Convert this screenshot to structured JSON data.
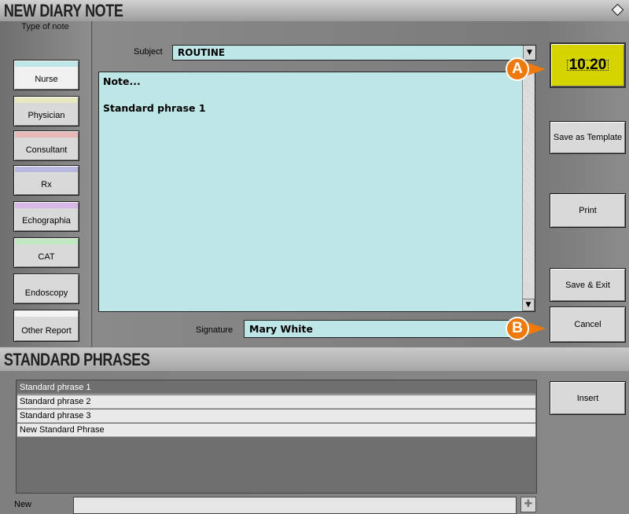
{
  "header": {
    "title": "NEW DIARY NOTE",
    "window_icon": "diamond-icon"
  },
  "note_types": {
    "label": "Type of note",
    "items": [
      {
        "label": "Nurse",
        "color": "#bfe6e6"
      },
      {
        "label": "Physician",
        "color": "#e8e8c0"
      },
      {
        "label": "Consultant",
        "color": "#e8b8b8"
      },
      {
        "label": "Rx",
        "color": "#b8b8e0"
      },
      {
        "label": "Echographia",
        "color": "#d8b8e8"
      },
      {
        "label": "CAT",
        "color": "#c0e8c0"
      },
      {
        "label": "Endoscopy",
        "color": "#d8d8d8"
      },
      {
        "label": "Other Report",
        "color": "#f0f0f0"
      }
    ]
  },
  "subject": {
    "label": "Subject",
    "value": "ROUTINE"
  },
  "note": {
    "line1": "Note...",
    "line2": "Standard phrase 1"
  },
  "signature": {
    "label": "Signature",
    "value": "Mary White"
  },
  "actions": {
    "time": "10.20",
    "save_template": "Save as Template",
    "print": "Print",
    "save_exit": "Save & Exit",
    "cancel": "Cancel"
  },
  "callouts": {
    "a": "A",
    "b": "B",
    "color": "#ee7a0d"
  },
  "standard_phrases": {
    "title": "STANDARD PHRASES",
    "items": [
      "Standard phrase 1",
      "Standard phrase 2",
      "Standard phrase 3",
      "New Standard Phrase"
    ],
    "selected_index": 0,
    "insert_label": "Insert",
    "new_label": "New",
    "new_value": "",
    "add_icon": "plus-icon"
  }
}
